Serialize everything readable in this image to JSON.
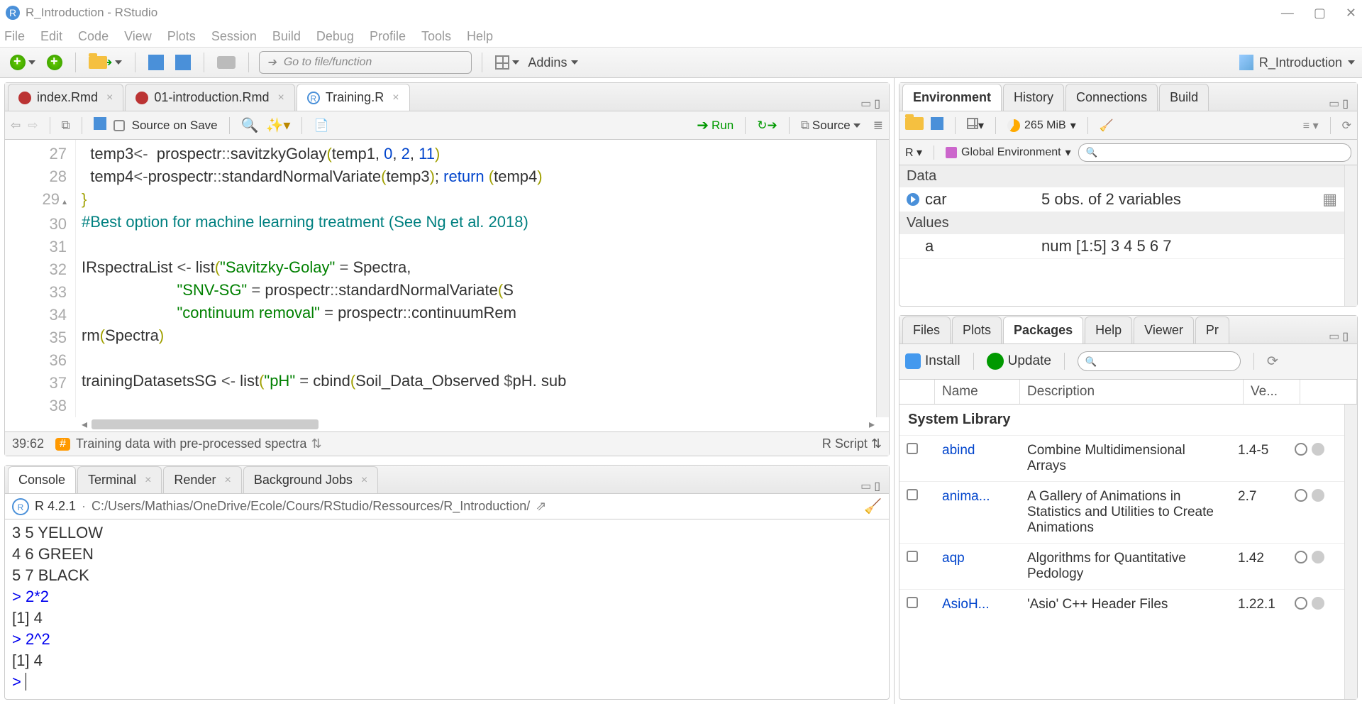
{
  "window": {
    "title": "R_Introduction - RStudio"
  },
  "menu": [
    "File",
    "Edit",
    "Code",
    "View",
    "Plots",
    "Session",
    "Build",
    "Debug",
    "Profile",
    "Tools",
    "Help"
  ],
  "toolbar": {
    "goto_placeholder": "Go to file/function",
    "addins": "Addins",
    "project": "R_Introduction"
  },
  "source": {
    "tabs": [
      {
        "label": "index.Rmd",
        "icon": "rmd"
      },
      {
        "label": "01-introduction.Rmd",
        "icon": "rmd"
      },
      {
        "label": "Training.R",
        "icon": "r",
        "active": true
      }
    ],
    "source_on_save": "Source on Save",
    "run": "Run",
    "source_btn": "Source",
    "gutter_lines": [
      "27",
      "28",
      "29",
      "30",
      "31",
      "32",
      "33",
      "34",
      "35",
      "36",
      "37",
      "38"
    ],
    "status_pos": "39:62",
    "status_section": "Training data with pre-processed spectra",
    "status_type": "R Script"
  },
  "console": {
    "tabs": [
      "Console",
      "Terminal",
      "Render",
      "Background Jobs"
    ],
    "version": "R 4.2.1",
    "path": "C:/Users/Mathias/OneDrive/Ecole/Cours/RStudio/Ressources/R_Introduction/",
    "lines": [
      {
        "raw": "3        5  YELLOW"
      },
      {
        "raw": "4        6   GREEN"
      },
      {
        "raw": "5        7   BLACK"
      },
      {
        "prompt": "> ",
        "input": "2*2"
      },
      {
        "raw": "[1]  4"
      },
      {
        "prompt": "> ",
        "input": "2^2"
      },
      {
        "raw": "[1]  4"
      },
      {
        "prompt": "> ",
        "input": ""
      }
    ]
  },
  "env": {
    "tabs": [
      "Environment",
      "History",
      "Connections",
      "Build"
    ],
    "scope_r": "R",
    "scope_env": "Global Environment",
    "memory": "265 MiB",
    "sections": {
      "Data": [
        {
          "name": "car",
          "value": "5 obs. of 2 variables",
          "expand": true
        }
      ],
      "Values": [
        {
          "name": "a",
          "value": "num [1:5] 3 4 5 6 7"
        }
      ]
    }
  },
  "pkg": {
    "tabs": [
      "Files",
      "Plots",
      "Packages",
      "Help",
      "Viewer",
      "Pr"
    ],
    "install": "Install",
    "update": "Update",
    "cols": {
      "name": "Name",
      "desc": "Description",
      "ver": "Ve..."
    },
    "section": "System Library",
    "rows": [
      {
        "name": "abind",
        "desc": "Combine Multidimensional Arrays",
        "ver": "1.4-5"
      },
      {
        "name": "anima...",
        "desc": "A Gallery of Animations in Statistics and Utilities to Create Animations",
        "ver": "2.7"
      },
      {
        "name": "aqp",
        "desc": "Algorithms for Quantitative Pedology",
        "ver": "1.42"
      },
      {
        "name": "AsioH...",
        "desc": "'Asio' C++ Header Files",
        "ver": "1.22.1"
      }
    ]
  }
}
